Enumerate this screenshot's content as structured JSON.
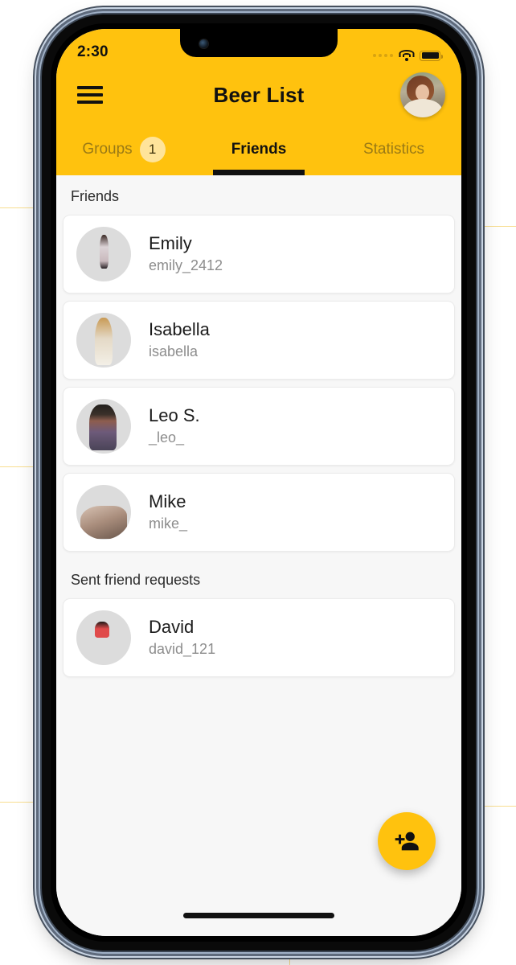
{
  "status_bar": {
    "time": "2:30",
    "cellular_icon": "cellular-dots-icon",
    "wifi_icon": "wifi-icon",
    "battery_icon": "battery-full-icon"
  },
  "header": {
    "menu_icon": "hamburger-menu-icon",
    "title": "Beer List",
    "avatar_label": "profile-avatar"
  },
  "tabs": [
    {
      "label": "Groups",
      "badge": "1",
      "active": false
    },
    {
      "label": "Friends",
      "badge": "",
      "active": true
    },
    {
      "label": "Statistics",
      "badge": "",
      "active": false
    }
  ],
  "sections": [
    {
      "title": "Friends",
      "items": [
        {
          "name": "Emily",
          "handle": "emily_2412",
          "avatar": "av-emily"
        },
        {
          "name": "Isabella",
          "handle": "isabella",
          "avatar": "av-isabella"
        },
        {
          "name": "Leo S.",
          "handle": "_leo_",
          "avatar": "av-leo"
        },
        {
          "name": "Mike",
          "handle": "mike_",
          "avatar": "av-mike"
        }
      ]
    },
    {
      "title": "Sent friend requests",
      "items": [
        {
          "name": "David",
          "handle": "david_121",
          "avatar": "av-david"
        }
      ]
    }
  ],
  "fab": {
    "icon": "person-add-icon",
    "label": "Add friend"
  },
  "colors": {
    "brand_yellow": "#FFC20E",
    "badge_yellow": "#FFE49A",
    "content_bg": "#F7F7F7",
    "card_bg": "#FFFFFF",
    "primary_text": "#1B1B1B",
    "secondary_text": "#8D8D8D",
    "inactive_tab_text": "#9A7A16"
  }
}
